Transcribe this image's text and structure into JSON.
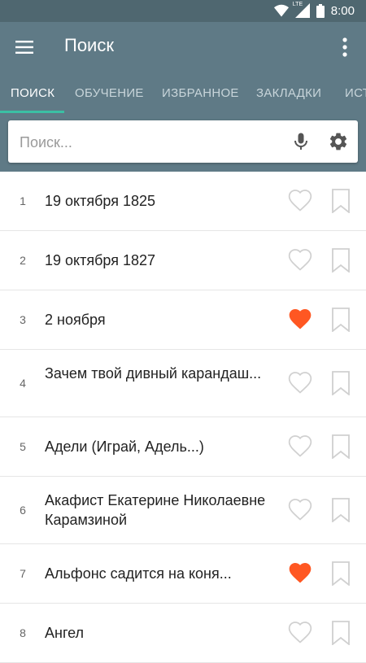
{
  "status": {
    "time": "8:00",
    "network": "LTE"
  },
  "toolbar": {
    "title": "Поиск"
  },
  "tabs": [
    {
      "label": "ПОИСК",
      "active": true
    },
    {
      "label": "ОБУЧЕНИЕ",
      "active": false
    },
    {
      "label": "ИЗБРАННОЕ",
      "active": false
    },
    {
      "label": "ЗАКЛАДКИ",
      "active": false
    },
    {
      "label": "ИСТ",
      "active": false
    }
  ],
  "search": {
    "placeholder": "Поиск..."
  },
  "colors": {
    "accent": "#3bc0a4",
    "heart_active": "#ff5722",
    "icon_inactive": "#d0d0d0",
    "toolbar": "#5f7a86",
    "statusbar": "#4f6770"
  },
  "items": [
    {
      "num": "1",
      "title": "19 октября 1825",
      "favorite": false,
      "lines": 1
    },
    {
      "num": "2",
      "title": "19 октября 1827",
      "favorite": false,
      "lines": 1
    },
    {
      "num": "3",
      "title": "2 ноября",
      "favorite": true,
      "lines": 1
    },
    {
      "num": "4",
      "title": "Зачем твой дивный карандаш...",
      "favorite": false,
      "lines": 2
    },
    {
      "num": "5",
      "title": "Адели (Играй, Адель...)",
      "favorite": false,
      "lines": 1
    },
    {
      "num": "6",
      "title": "Акафист Екатерине Николаевне Карамзиной",
      "favorite": false,
      "lines": 2
    },
    {
      "num": "7",
      "title": "Альфонс садится на коня...",
      "favorite": true,
      "lines": 1
    },
    {
      "num": "8",
      "title": "Ангел",
      "favorite": false,
      "lines": 1
    }
  ]
}
